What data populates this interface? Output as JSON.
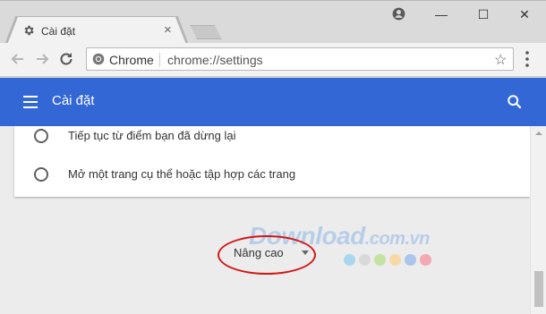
{
  "window": {
    "tab_title": "Cài đặt",
    "tab_close": "×",
    "minimize": "—",
    "maximize": "☐",
    "close": "✕"
  },
  "toolbar": {
    "site_chip": "Chrome",
    "url": "chrome://settings",
    "star": "☆"
  },
  "header": {
    "title": "Cài đặt"
  },
  "startup": {
    "options": [
      {
        "label": "Tiếp tục từ điểm bạn đã dừng lại"
      },
      {
        "label": "Mở một trang cụ thể hoặc tập hợp các trang"
      }
    ]
  },
  "advanced": {
    "label": "Nâng cao"
  },
  "watermark": {
    "brand": "Download",
    "domain": ".com.vn",
    "dot_colors": [
      "#a9d8ee",
      "#d9d9d9",
      "#c4e3a2",
      "#f8d9a6",
      "#a9c6ea",
      "#f4a9b0"
    ]
  },
  "colors": {
    "header_bg": "#3367d6",
    "annotation_circle": "#d41717"
  }
}
